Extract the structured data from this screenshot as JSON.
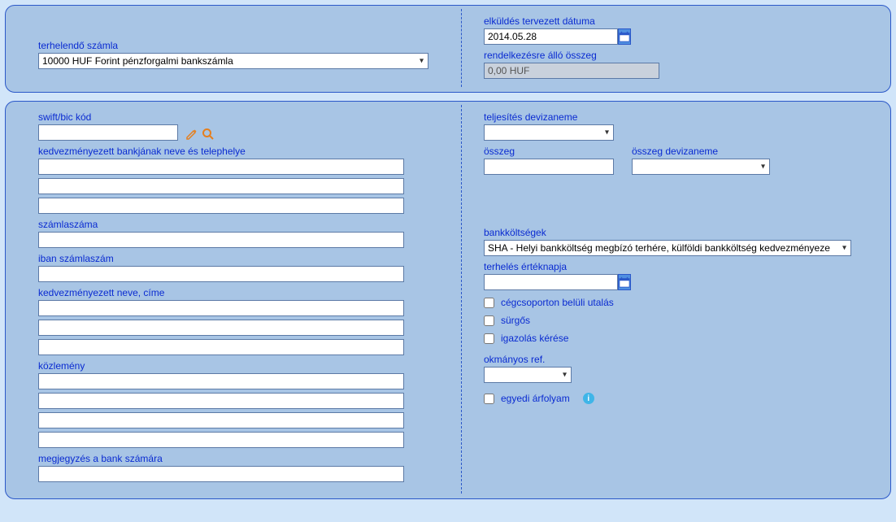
{
  "panel1": {
    "account_label": "terhelendő számla",
    "account_value": "10000 HUF Forint pénzforgalmi bankszámla",
    "planned_date_label": "elküldés tervezett dátuma",
    "planned_date_value": "2014.05.28",
    "available_label": "rendelkezésre álló összeg",
    "available_value": "0,00 HUF"
  },
  "panel2": {
    "swift_label": "swift/bic kód",
    "swift_value": "",
    "bank_name_label": "kedvezményezett bankjának neve és telephelye",
    "bank_name": [
      "",
      "",
      ""
    ],
    "account_no_label": "számlaszáma",
    "account_no_value": "",
    "iban_label": "iban számlaszám",
    "iban_value": "",
    "bene_label": "kedvezményezett neve, címe",
    "bene": [
      "",
      "",
      ""
    ],
    "remit_label": "közlemény",
    "remit": [
      "",
      "",
      "",
      ""
    ],
    "note_label": "megjegyzés a bank számára",
    "note_value": "",
    "ccy_exec_label": "teljesítés devizaneme",
    "ccy_exec_value": "",
    "amount_label": "összeg",
    "amount_value": "",
    "amount_ccy_label": "összeg devizaneme",
    "amount_ccy_value": "",
    "charges_label": "bankköltségek",
    "charges_value": "SHA - Helyi bankköltség megbízó terhére, külföldi bankköltség kedvezményeze",
    "value_date_label": "terhelés értéknapja",
    "value_date_value": "",
    "chk_intragroup": "cégcsoporton belüli utalás",
    "chk_urgent": "sürgős",
    "chk_confirm": "igazolás kérése",
    "doc_ref_label": "okmányos ref.",
    "doc_ref_value": "",
    "chk_rate": "egyedi árfolyam"
  }
}
